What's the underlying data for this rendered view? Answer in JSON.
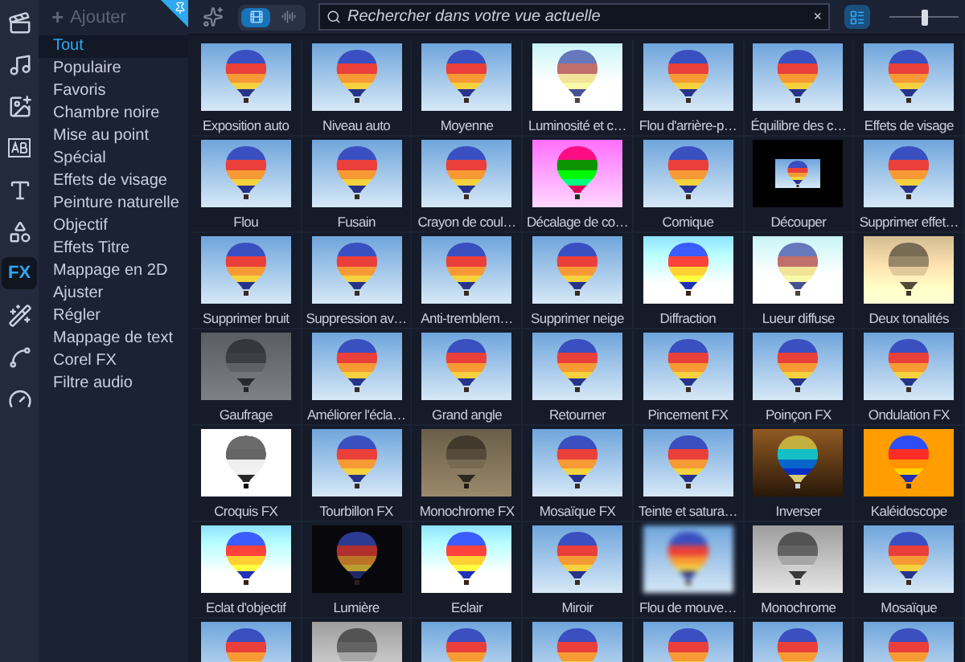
{
  "left_toolbar": [
    {
      "kind": "media",
      "selected": false
    },
    {
      "kind": "music",
      "selected": false
    },
    {
      "kind": "instant",
      "selected": false
    },
    {
      "kind": "titles-box",
      "selected": false
    },
    {
      "kind": "text",
      "selected": false
    },
    {
      "kind": "transition",
      "selected": false
    },
    {
      "kind": "fx",
      "label": "FX",
      "selected": true
    },
    {
      "kind": "wand",
      "selected": false
    },
    {
      "kind": "path",
      "selected": false
    },
    {
      "kind": "gauge",
      "selected": false
    }
  ],
  "category_panel": {
    "add_button": {
      "icon": "+",
      "label": "Ajouter",
      "disabled": true
    },
    "pinned": true,
    "items": [
      {
        "label": "Tout",
        "selected": true
      },
      {
        "label": "Populaire",
        "selected": false
      },
      {
        "label": "Favoris",
        "selected": false
      },
      {
        "label": "Chambre noire",
        "selected": false
      },
      {
        "label": "Mise au point",
        "selected": false
      },
      {
        "label": "Spécial",
        "selected": false
      },
      {
        "label": "Effets de visage",
        "selected": false
      },
      {
        "label": "Peinture naturelle",
        "selected": false
      },
      {
        "label": "Objectif",
        "selected": false
      },
      {
        "label": "Effets Titre",
        "selected": false
      },
      {
        "label": "Mappage en 2D",
        "selected": false
      },
      {
        "label": "Ajuster",
        "selected": false
      },
      {
        "label": "Régler",
        "selected": false
      },
      {
        "label": "Mappage de text",
        "selected": false
      },
      {
        "label": "Corel FX",
        "selected": false
      },
      {
        "label": "Filtre audio",
        "selected": false
      }
    ]
  },
  "toolbar": {
    "view_toggle": [
      {
        "kind": "video",
        "selected": true
      },
      {
        "kind": "audio",
        "selected": false
      }
    ],
    "search": {
      "placeholder": "Rechercher dans votre vue actuelle",
      "clear": "×"
    },
    "layout_button": {
      "selected": true
    },
    "zoom_slider": {
      "level": 0.5
    }
  },
  "effects": [
    {
      "label": "Exposition auto",
      "kind": "normal"
    },
    {
      "label": "Niveau auto",
      "kind": "normal"
    },
    {
      "label": "Moyenne",
      "kind": "normal"
    },
    {
      "label": "Luminosité et c…",
      "kind": "bright"
    },
    {
      "label": "Flou d'arrière-p…",
      "kind": "normal"
    },
    {
      "label": "Équilibre des c…",
      "kind": "normal"
    },
    {
      "label": "Effets de visage",
      "kind": "normal"
    },
    {
      "label": "Flou",
      "kind": "normal"
    },
    {
      "label": "Fusain",
      "kind": "normal"
    },
    {
      "label": "Crayon de coul…",
      "kind": "normal"
    },
    {
      "label": "Décalage de co…",
      "kind": "offset"
    },
    {
      "label": "Comique",
      "kind": "normal"
    },
    {
      "label": "Découper",
      "kind": "framed"
    },
    {
      "label": "Supprimer effet…",
      "kind": "normal"
    },
    {
      "label": "Supprimer bruit",
      "kind": "normal"
    },
    {
      "label": "Suppression av…",
      "kind": "normal"
    },
    {
      "label": "Anti-tremblem…",
      "kind": "normal"
    },
    {
      "label": "Supprimer neige",
      "kind": "normal"
    },
    {
      "label": "Diffraction",
      "kind": "glow"
    },
    {
      "label": "Lueur diffuse",
      "kind": "bright"
    },
    {
      "label": "Deux tonalités",
      "kind": "sepia"
    },
    {
      "label": "Gaufrage",
      "kind": "emboss"
    },
    {
      "label": "Améliorer l'écla…",
      "kind": "normal"
    },
    {
      "label": "Grand angle",
      "kind": "normal"
    },
    {
      "label": "Retourner",
      "kind": "normal"
    },
    {
      "label": "Pincement FX",
      "kind": "normal"
    },
    {
      "label": "Poinçon FX",
      "kind": "normal"
    },
    {
      "label": "Ondulation FX",
      "kind": "normal"
    },
    {
      "label": "Croquis FX",
      "kind": "sketch"
    },
    {
      "label": "Tourbillon FX",
      "kind": "normal"
    },
    {
      "label": "Monochrome FX",
      "kind": "amber"
    },
    {
      "label": "Mosaïque FX",
      "kind": "normal"
    },
    {
      "label": "Teinte et satura…",
      "kind": "normal"
    },
    {
      "label": "Inverser",
      "kind": "inverse"
    },
    {
      "label": "Kaléidoscope",
      "kind": "kaleido"
    },
    {
      "label": "Eclat d'objectif",
      "kind": "glow"
    },
    {
      "label": "Lumière",
      "kind": "dark"
    },
    {
      "label": "Eclair",
      "kind": "glow"
    },
    {
      "label": "Miroir",
      "kind": "normal"
    },
    {
      "label": "Flou de mouve…",
      "kind": "blur"
    },
    {
      "label": "Monochrome",
      "kind": "mono"
    },
    {
      "label": "Mosaïque",
      "kind": "normal"
    },
    {
      "kind": "normal"
    },
    {
      "kind": "mono"
    },
    {
      "kind": "normal"
    },
    {
      "kind": "normal"
    },
    {
      "kind": "normal"
    },
    {
      "kind": "normal"
    },
    {
      "kind": "normal"
    }
  ]
}
